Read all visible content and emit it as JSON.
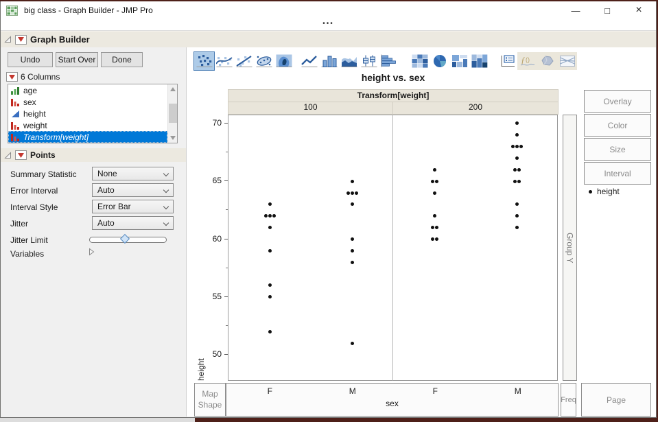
{
  "window": {
    "title": "big class - Graph Builder - JMP Pro",
    "grab_handle": "•••",
    "controls": {
      "minimize": "—",
      "maximize": "□",
      "close": "×"
    }
  },
  "outline_header": {
    "title": "Graph Builder"
  },
  "action_buttons": {
    "undo": "Undo",
    "start_over": "Start Over",
    "done": "Done"
  },
  "columns": {
    "header": "6 Columns",
    "items": [
      {
        "label": "age",
        "icon": "ordinal-icon",
        "selected": false
      },
      {
        "label": "sex",
        "icon": "nominal-icon",
        "selected": false
      },
      {
        "label": "height",
        "icon": "continuous-icon",
        "selected": false
      },
      {
        "label": "weight",
        "icon": "nominal-icon",
        "selected": false
      },
      {
        "label": "Transform[weight]",
        "icon": "nominal-icon",
        "selected": true
      }
    ]
  },
  "points_panel": {
    "title": "Points",
    "dropdowns": [
      {
        "label": "Summary Statistic",
        "value": "None"
      },
      {
        "label": "Error Interval",
        "value": "Auto"
      },
      {
        "label": "Interval Style",
        "value": "Error Bar"
      },
      {
        "label": "Jitter",
        "value": "Auto"
      }
    ],
    "jitter_limit_label": "Jitter Limit",
    "jitter_limit_value": 0.45,
    "variables_label": "Variables"
  },
  "toolbar": {
    "groups": [
      [
        "points",
        "smoother",
        "line-of-fit",
        "ellipse",
        "contour"
      ],
      [
        "line",
        "bar",
        "area",
        "box-plot",
        "histogram"
      ],
      [
        "heatmap",
        "pie",
        "treemap",
        "mosaic"
      ],
      [
        "caption-box",
        "formula",
        "map-shapes",
        "parallel-plot"
      ]
    ],
    "selected": "points",
    "disabled": [
      "formula",
      "map-shapes",
      "parallel-plot"
    ]
  },
  "drop_zones": {
    "right": [
      "Overlay",
      "Color",
      "Size",
      "Interval"
    ],
    "group_y": "Group Y",
    "map_shape": "Map Shape",
    "freq": "Freq",
    "page": "Page"
  },
  "legend": {
    "items": [
      {
        "marker": "dot",
        "label": "height"
      }
    ]
  },
  "chart_data": {
    "type": "scatter",
    "title": "height vs. sex",
    "group_label": "Transform[weight]",
    "panels": [
      "100",
      "200"
    ],
    "x_categories": [
      "F",
      "M"
    ],
    "xlabel": "sex",
    "ylabel": "height",
    "y_ticks": [
      50,
      55,
      60,
      65,
      70
    ],
    "ylim": [
      47.7,
      70.7
    ],
    "grid": false,
    "points": [
      {
        "panel": "100",
        "sex": "F",
        "height": 63,
        "jx": 0
      },
      {
        "panel": "100",
        "sex": "F",
        "height": 62,
        "jx": -6
      },
      {
        "panel": "100",
        "sex": "F",
        "height": 62,
        "jx": 0
      },
      {
        "panel": "100",
        "sex": "F",
        "height": 62,
        "jx": 6
      },
      {
        "panel": "100",
        "sex": "F",
        "height": 61,
        "jx": 0
      },
      {
        "panel": "100",
        "sex": "F",
        "height": 59,
        "jx": 0
      },
      {
        "panel": "100",
        "sex": "F",
        "height": 56,
        "jx": 0
      },
      {
        "panel": "100",
        "sex": "F",
        "height": 55,
        "jx": 0
      },
      {
        "panel": "100",
        "sex": "F",
        "height": 52,
        "jx": 0
      },
      {
        "panel": "100",
        "sex": "M",
        "height": 65,
        "jx": 0
      },
      {
        "panel": "100",
        "sex": "M",
        "height": 64,
        "jx": -6
      },
      {
        "panel": "100",
        "sex": "M",
        "height": 64,
        "jx": 0
      },
      {
        "panel": "100",
        "sex": "M",
        "height": 64,
        "jx": 6
      },
      {
        "panel": "100",
        "sex": "M",
        "height": 63,
        "jx": 0
      },
      {
        "panel": "100",
        "sex": "M",
        "height": 60,
        "jx": 0
      },
      {
        "panel": "100",
        "sex": "M",
        "height": 59,
        "jx": 0
      },
      {
        "panel": "100",
        "sex": "M",
        "height": 58,
        "jx": 0
      },
      {
        "panel": "100",
        "sex": "M",
        "height": 51,
        "jx": 0
      },
      {
        "panel": "200",
        "sex": "F",
        "height": 66,
        "jx": 0
      },
      {
        "panel": "200",
        "sex": "F",
        "height": 65,
        "jx": -3
      },
      {
        "panel": "200",
        "sex": "F",
        "height": 65,
        "jx": 3
      },
      {
        "panel": "200",
        "sex": "F",
        "height": 64,
        "jx": 0
      },
      {
        "panel": "200",
        "sex": "F",
        "height": 62,
        "jx": 0
      },
      {
        "panel": "200",
        "sex": "F",
        "height": 61,
        "jx": -3
      },
      {
        "panel": "200",
        "sex": "F",
        "height": 61,
        "jx": 3
      },
      {
        "panel": "200",
        "sex": "F",
        "height": 60,
        "jx": -3
      },
      {
        "panel": "200",
        "sex": "F",
        "height": 60,
        "jx": 3
      },
      {
        "panel": "200",
        "sex": "M",
        "height": 70,
        "jx": 0
      },
      {
        "panel": "200",
        "sex": "M",
        "height": 69,
        "jx": 0
      },
      {
        "panel": "200",
        "sex": "M",
        "height": 68,
        "jx": -6
      },
      {
        "panel": "200",
        "sex": "M",
        "height": 68,
        "jx": 0
      },
      {
        "panel": "200",
        "sex": "M",
        "height": 68,
        "jx": 6
      },
      {
        "panel": "200",
        "sex": "M",
        "height": 67,
        "jx": 0
      },
      {
        "panel": "200",
        "sex": "M",
        "height": 66,
        "jx": -3
      },
      {
        "panel": "200",
        "sex": "M",
        "height": 66,
        "jx": 3
      },
      {
        "panel": "200",
        "sex": "M",
        "height": 65,
        "jx": -3
      },
      {
        "panel": "200",
        "sex": "M",
        "height": 65,
        "jx": 3
      },
      {
        "panel": "200",
        "sex": "M",
        "height": 63,
        "jx": 0
      },
      {
        "panel": "200",
        "sex": "M",
        "height": 62,
        "jx": 0
      },
      {
        "panel": "200",
        "sex": "M",
        "height": 61,
        "jx": 0
      }
    ]
  }
}
